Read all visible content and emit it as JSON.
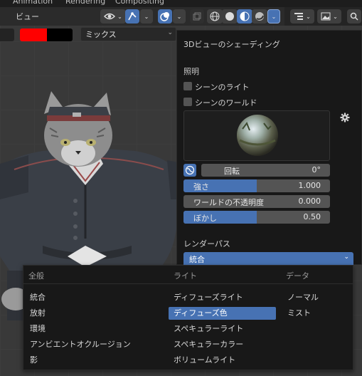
{
  "top_menu": [
    "Animation",
    "Rendering",
    "Compositing"
  ],
  "header": {
    "view_label": "ビュー"
  },
  "toolbar": {
    "mix_mode": "ミックス"
  },
  "colors": {
    "accent": "#4772b3",
    "swatch_primary": "#ff0000",
    "swatch_secondary": "#000000"
  },
  "popover": {
    "title": "3Dビューのシェーディング",
    "lighting_label": "照明",
    "scene_lights": "シーンのライト",
    "scene_world": "シーンのワールド",
    "rotation": {
      "label": "回転",
      "value": "0°"
    },
    "strength": {
      "label": "強さ",
      "value": "1.000",
      "fraction": 0.5
    },
    "world_opacity": {
      "label": "ワールドの不透明度",
      "value": "0.000",
      "fraction": 0.0
    },
    "blur": {
      "label": "ぼかし",
      "value": "0.50",
      "fraction": 0.5
    },
    "render_pass_label": "レンダーパス",
    "render_pass_value": "統合"
  },
  "menu": {
    "columns": [
      {
        "header": "全般",
        "items": [
          "統合",
          "放射",
          "環境",
          "アンビエントオクルージョン",
          "影"
        ]
      },
      {
        "header": "ライト",
        "items": [
          "ディフューズライト",
          "ディフューズ色",
          "スペキュラーライト",
          "スペキュラーカラー",
          "ボリュームライト"
        ]
      },
      {
        "header": "データ",
        "items": [
          "ノーマル",
          "ミスト"
        ]
      }
    ],
    "selected": "ディフューズ色"
  }
}
